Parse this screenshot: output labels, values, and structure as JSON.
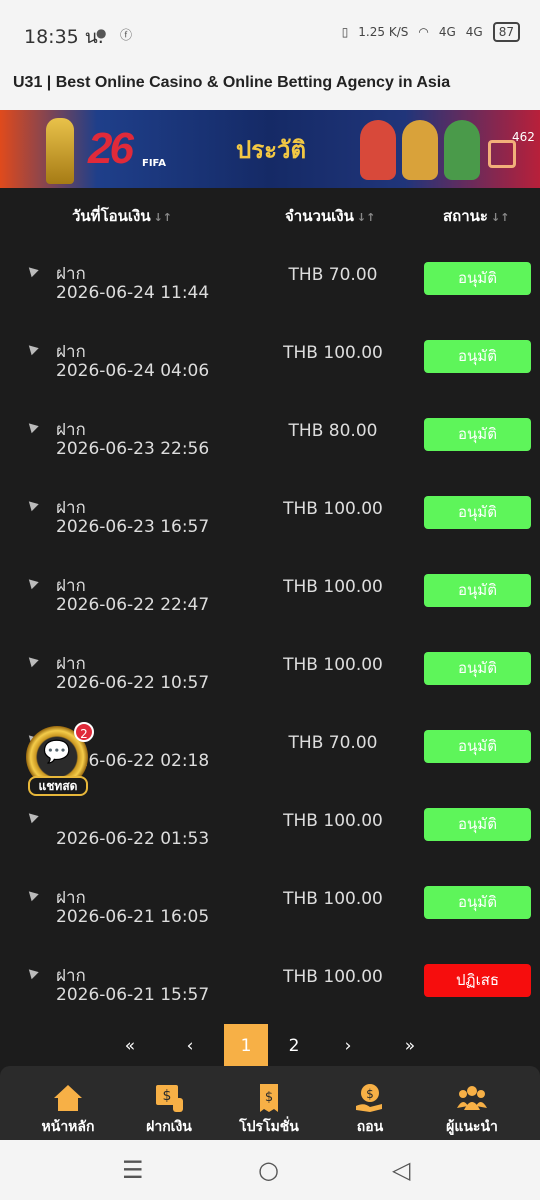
{
  "status_bar": {
    "time": "18:35 น.",
    "speed": "1.25 K/S",
    "network1": "4G",
    "network2": "4G",
    "battery": "87"
  },
  "page_title": "U31 | Best Online Casino & Online Betting Agency in Asia",
  "banner": {
    "heading": "ประวัติ",
    "logo_number": "26",
    "fifa": "FIFA",
    "notification_count": "462"
  },
  "table": {
    "col_date": "วันที่โอนเงิน",
    "col_amount": "จำนวนเงิน",
    "col_status": "สถานะ",
    "sort_glyph": "↓↑",
    "rows": [
      {
        "type": "ฝาก",
        "date": "2026-06-24 11:44",
        "amount": "THB 70.00",
        "status": "อนุมัติ",
        "state": "approved"
      },
      {
        "type": "ฝาก",
        "date": "2026-06-24 04:06",
        "amount": "THB 100.00",
        "status": "อนุมัติ",
        "state": "approved"
      },
      {
        "type": "ฝาก",
        "date": "2026-06-23 22:56",
        "amount": "THB 80.00",
        "status": "อนุมัติ",
        "state": "approved"
      },
      {
        "type": "ฝาก",
        "date": "2026-06-23 16:57",
        "amount": "THB 100.00",
        "status": "อนุมัติ",
        "state": "approved"
      },
      {
        "type": "ฝาก",
        "date": "2026-06-22 22:47",
        "amount": "THB 100.00",
        "status": "อนุมัติ",
        "state": "approved"
      },
      {
        "type": "ฝาก",
        "date": "2026-06-22 10:57",
        "amount": "THB 100.00",
        "status": "อนุมัติ",
        "state": "approved"
      },
      {
        "type": "",
        "date": "2026-06-22 02:18",
        "amount": "THB 70.00",
        "status": "อนุมัติ",
        "state": "approved"
      },
      {
        "type": "",
        "date": "2026-06-22 01:53",
        "amount": "THB 100.00",
        "status": "อนุมัติ",
        "state": "approved"
      },
      {
        "type": "ฝาก",
        "date": "2026-06-21 16:05",
        "amount": "THB 100.00",
        "status": "อนุมัติ",
        "state": "approved"
      },
      {
        "type": "ฝาก",
        "date": "2026-06-21 15:57",
        "amount": "THB 100.00",
        "status": "ปฏิเสธ",
        "state": "rejected"
      }
    ]
  },
  "chat_widget": {
    "label": "แชทสด",
    "badge": "2"
  },
  "pagination": {
    "first": "«",
    "prev": "‹",
    "page1": "1",
    "page2": "2",
    "next": "›",
    "last": "»",
    "current": "1"
  },
  "bottom_nav": {
    "home": "หน้าหลัก",
    "deposit": "ฝากเงิน",
    "promotion": "โปรโมชั่น",
    "withdraw": "ถอน",
    "referral": "ผู้แนะนำ"
  },
  "colors": {
    "approved": "#5ef55a",
    "rejected": "#f60d0d",
    "accent": "#f7b046",
    "background": "#1c1c1c"
  }
}
